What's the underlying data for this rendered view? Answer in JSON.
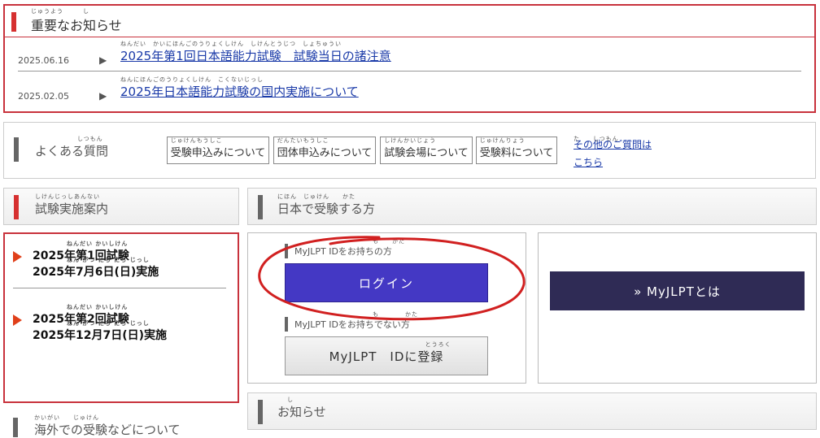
{
  "notice": {
    "title": "重要なお知らせ",
    "title_ruby": "じゅうよう　　　し",
    "items": [
      {
        "date": "2025.06.16",
        "text": "2025年第1回日本語能力試験　試験当日の諸注意",
        "ruby": "ねんだい　かいにほんごのうりょくしけん　しけんとうじつ　しょちゅうい"
      },
      {
        "date": "2025.02.05",
        "text": "2025年日本語能力試験の国内実施について",
        "ruby": "ねんにほんごのうりょくしけん　こくないじっし"
      }
    ]
  },
  "faq": {
    "label": "よくある質問",
    "label_ruby": "しつもん",
    "buttons": [
      {
        "label": "受験申込みについて",
        "ruby": "じゅけんもうしこ"
      },
      {
        "label": "団体申込みについて",
        "ruby": "だんたいもうしこ"
      },
      {
        "label": "試験会場について",
        "ruby": "しけんかいじょう"
      },
      {
        "label": "受験料について",
        "ruby": "じゅけんりょう"
      }
    ],
    "other_line1": "その他のご質問は",
    "other_line2": "こちら",
    "other_ruby": "た　　しつもん"
  },
  "exam_info": {
    "title": "試験実施案内",
    "title_ruby": "しけんじっしあんない",
    "items": [
      {
        "line1": "2025年第1回試験",
        "line2": "2025年7月6日(日)実施",
        "ruby1": "ねんだい かいしけん",
        "ruby2": "ねん がつ にち にち じっし"
      },
      {
        "line1": "2025年第2回試験",
        "line2": "2025年12月7日(日)実施",
        "ruby1": "ねんだい かいしけん",
        "ruby2": "ねん がつ にち にち じっし"
      }
    ]
  },
  "overseas": {
    "title": "海外での受験などについて",
    "ruby": "かいがい　　じゅけん"
  },
  "japan": {
    "title": "日本で受験する方",
    "title_ruby": "にほん　じゅけん　　かた",
    "have_id_label": "MyJLPT IDをお持ちの方",
    "have_id_ruby": "も　　かた",
    "login_label": "ログイン",
    "no_id_label": "MyJLPT IDをお持ちでない方",
    "no_id_ruby": "も　　　　かた",
    "register_label": "MyJLPT　IDに登録",
    "register_ruby": "とうろく",
    "about_label": "» MyJLPTとは"
  },
  "news": {
    "title": "お知らせ",
    "ruby": "し"
  },
  "colors": {
    "accent_red": "#c8323c",
    "login_blue": "#4438c4",
    "about_navy": "#2f2b55",
    "link_blue": "#1a3aa8",
    "annotation_red": "#d12020"
  }
}
